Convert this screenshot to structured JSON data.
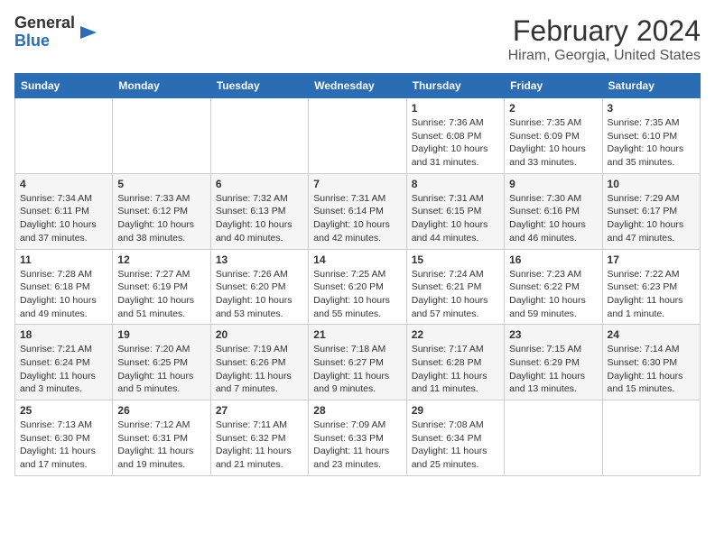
{
  "logo": {
    "general": "General",
    "blue": "Blue"
  },
  "title": "February 2024",
  "subtitle": "Hiram, Georgia, United States",
  "days_of_week": [
    "Sunday",
    "Monday",
    "Tuesday",
    "Wednesday",
    "Thursday",
    "Friday",
    "Saturday"
  ],
  "weeks": [
    [
      {
        "num": "",
        "info": ""
      },
      {
        "num": "",
        "info": ""
      },
      {
        "num": "",
        "info": ""
      },
      {
        "num": "",
        "info": ""
      },
      {
        "num": "1",
        "info": "Sunrise: 7:36 AM\nSunset: 6:08 PM\nDaylight: 10 hours and 31 minutes."
      },
      {
        "num": "2",
        "info": "Sunrise: 7:35 AM\nSunset: 6:09 PM\nDaylight: 10 hours and 33 minutes."
      },
      {
        "num": "3",
        "info": "Sunrise: 7:35 AM\nSunset: 6:10 PM\nDaylight: 10 hours and 35 minutes."
      }
    ],
    [
      {
        "num": "4",
        "info": "Sunrise: 7:34 AM\nSunset: 6:11 PM\nDaylight: 10 hours and 37 minutes."
      },
      {
        "num": "5",
        "info": "Sunrise: 7:33 AM\nSunset: 6:12 PM\nDaylight: 10 hours and 38 minutes."
      },
      {
        "num": "6",
        "info": "Sunrise: 7:32 AM\nSunset: 6:13 PM\nDaylight: 10 hours and 40 minutes."
      },
      {
        "num": "7",
        "info": "Sunrise: 7:31 AM\nSunset: 6:14 PM\nDaylight: 10 hours and 42 minutes."
      },
      {
        "num": "8",
        "info": "Sunrise: 7:31 AM\nSunset: 6:15 PM\nDaylight: 10 hours and 44 minutes."
      },
      {
        "num": "9",
        "info": "Sunrise: 7:30 AM\nSunset: 6:16 PM\nDaylight: 10 hours and 46 minutes."
      },
      {
        "num": "10",
        "info": "Sunrise: 7:29 AM\nSunset: 6:17 PM\nDaylight: 10 hours and 47 minutes."
      }
    ],
    [
      {
        "num": "11",
        "info": "Sunrise: 7:28 AM\nSunset: 6:18 PM\nDaylight: 10 hours and 49 minutes."
      },
      {
        "num": "12",
        "info": "Sunrise: 7:27 AM\nSunset: 6:19 PM\nDaylight: 10 hours and 51 minutes."
      },
      {
        "num": "13",
        "info": "Sunrise: 7:26 AM\nSunset: 6:20 PM\nDaylight: 10 hours and 53 minutes."
      },
      {
        "num": "14",
        "info": "Sunrise: 7:25 AM\nSunset: 6:20 PM\nDaylight: 10 hours and 55 minutes."
      },
      {
        "num": "15",
        "info": "Sunrise: 7:24 AM\nSunset: 6:21 PM\nDaylight: 10 hours and 57 minutes."
      },
      {
        "num": "16",
        "info": "Sunrise: 7:23 AM\nSunset: 6:22 PM\nDaylight: 10 hours and 59 minutes."
      },
      {
        "num": "17",
        "info": "Sunrise: 7:22 AM\nSunset: 6:23 PM\nDaylight: 11 hours and 1 minute."
      }
    ],
    [
      {
        "num": "18",
        "info": "Sunrise: 7:21 AM\nSunset: 6:24 PM\nDaylight: 11 hours and 3 minutes."
      },
      {
        "num": "19",
        "info": "Sunrise: 7:20 AM\nSunset: 6:25 PM\nDaylight: 11 hours and 5 minutes."
      },
      {
        "num": "20",
        "info": "Sunrise: 7:19 AM\nSunset: 6:26 PM\nDaylight: 11 hours and 7 minutes."
      },
      {
        "num": "21",
        "info": "Sunrise: 7:18 AM\nSunset: 6:27 PM\nDaylight: 11 hours and 9 minutes."
      },
      {
        "num": "22",
        "info": "Sunrise: 7:17 AM\nSunset: 6:28 PM\nDaylight: 11 hours and 11 minutes."
      },
      {
        "num": "23",
        "info": "Sunrise: 7:15 AM\nSunset: 6:29 PM\nDaylight: 11 hours and 13 minutes."
      },
      {
        "num": "24",
        "info": "Sunrise: 7:14 AM\nSunset: 6:30 PM\nDaylight: 11 hours and 15 minutes."
      }
    ],
    [
      {
        "num": "25",
        "info": "Sunrise: 7:13 AM\nSunset: 6:30 PM\nDaylight: 11 hours and 17 minutes."
      },
      {
        "num": "26",
        "info": "Sunrise: 7:12 AM\nSunset: 6:31 PM\nDaylight: 11 hours and 19 minutes."
      },
      {
        "num": "27",
        "info": "Sunrise: 7:11 AM\nSunset: 6:32 PM\nDaylight: 11 hours and 21 minutes."
      },
      {
        "num": "28",
        "info": "Sunrise: 7:09 AM\nSunset: 6:33 PM\nDaylight: 11 hours and 23 minutes."
      },
      {
        "num": "29",
        "info": "Sunrise: 7:08 AM\nSunset: 6:34 PM\nDaylight: 11 hours and 25 minutes."
      },
      {
        "num": "",
        "info": ""
      },
      {
        "num": "",
        "info": ""
      }
    ]
  ]
}
